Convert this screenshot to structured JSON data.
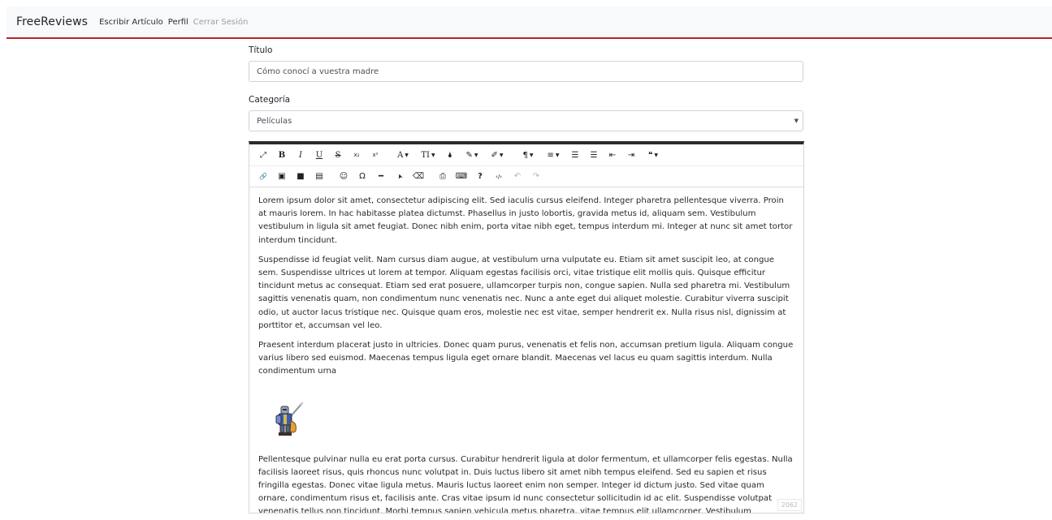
{
  "navbar": {
    "brand": "FreeReviews",
    "links": [
      "Escribir Artículo",
      "Perfil",
      "Cerrar Sesión"
    ]
  },
  "form": {
    "title_label": "Título",
    "title_value": "Cómo conocí a vuestra madre",
    "category_label": "Categoría",
    "category_value": "Películas"
  },
  "toolbar": {
    "row1": [
      {
        "name": "fullscreen-icon",
        "glyph": "⤢"
      },
      {
        "name": "bold-icon",
        "glyph": "B"
      },
      {
        "name": "italic-icon",
        "glyph": "I"
      },
      {
        "name": "underline-icon",
        "glyph": "U"
      },
      {
        "name": "strikethrough-icon",
        "glyph": "S"
      },
      {
        "name": "subscript-icon",
        "glyph": "x₂"
      },
      {
        "name": "superscript-icon",
        "glyph": "x²"
      },
      {
        "name": "font-family-icon",
        "glyph": "A"
      },
      {
        "name": "font-size-icon",
        "glyph": "TI"
      },
      {
        "name": "text-color-icon",
        "glyph": "🌢"
      },
      {
        "name": "background-color-icon",
        "glyph": "✎"
      },
      {
        "name": "inline-style-icon",
        "glyph": "✐"
      },
      {
        "name": "paragraph-format-icon",
        "glyph": "¶"
      },
      {
        "name": "align-icon",
        "glyph": "≡"
      },
      {
        "name": "ordered-list-icon",
        "glyph": "☰"
      },
      {
        "name": "unordered-list-icon",
        "glyph": "☰"
      },
      {
        "name": "outdent-icon",
        "glyph": "⇤"
      },
      {
        "name": "indent-icon",
        "glyph": "⇥"
      },
      {
        "name": "quote-icon",
        "glyph": "❝"
      }
    ],
    "row2": [
      {
        "name": "link-icon",
        "glyph": "🔗"
      },
      {
        "name": "image-icon",
        "glyph": "▣"
      },
      {
        "name": "video-icon",
        "glyph": "■"
      },
      {
        "name": "table-icon",
        "glyph": "▤"
      },
      {
        "name": "emoticon-icon",
        "glyph": "☺"
      },
      {
        "name": "special-characters-icon",
        "glyph": "Ω"
      },
      {
        "name": "horizontal-line-icon",
        "glyph": "━"
      },
      {
        "name": "select-all-icon",
        "glyph": "➤"
      },
      {
        "name": "clear-formatting-icon",
        "glyph": "⌫"
      },
      {
        "name": "print-icon",
        "glyph": "⎙"
      },
      {
        "name": "keyboard-icon",
        "glyph": "⌨"
      },
      {
        "name": "help-icon",
        "glyph": "?"
      },
      {
        "name": "code-view-icon",
        "glyph": "‹/›"
      },
      {
        "name": "undo-icon",
        "glyph": "↶"
      },
      {
        "name": "redo-icon",
        "glyph": "↷"
      }
    ]
  },
  "editor": {
    "paragraphs": [
      "Lorem ipsum dolor sit amet, consectetur adipiscing elit. Sed iaculis cursus eleifend. Integer pharetra pellentesque viverra. Proin at mauris lorem. In hac habitasse platea dictumst. Phasellus in justo lobortis, gravida metus id, aliquam sem. Vestibulum vestibulum in ligula sit amet feugiat. Donec nibh enim, porta vitae nibh eget, tempus interdum mi. Integer at nunc sit amet tortor interdum tincidunt.",
      "Suspendisse id feugiat velit. Nam cursus diam augue, at vestibulum urna vulputate eu. Etiam sit amet suscipit leo, at congue sem. Suspendisse ultrices ut lorem at tempor. Aliquam egestas facilisis orci, vitae tristique elit mollis quis. Quisque efficitur tincidunt metus ac consequat. Etiam sed erat posuere, ullamcorper turpis non, congue sapien. Nulla sed pharetra mi. Vestibulum sagittis venenatis quam, non condimentum nunc venenatis nec. Nunc a ante eget dui aliquet molestie. Curabitur viverra suscipit odio, ut auctor lacus tristique nec. Quisque quam eros, molestie nec est vitae, semper hendrerit ex. Nulla risus nisl, dignissim at porttitor et, accumsan vel leo.",
      "Praesent interdum placerat justo in ultricies. Donec quam purus, venenatis et felis non, accumsan pretium ligula. Aliquam congue varius libero sed euismod. Maecenas tempus ligula eget ornare blandit. Maecenas vel lacus eu quam sagittis interdum. Nulla condimentum urna",
      "Pellentesque pulvinar nulla eu erat porta cursus. Curabitur hendrerit ligula at dolor fermentum, et ullamcorper felis egestas. Nulla facilisis laoreet risus, quis rhoncus nunc volutpat in. Duis luctus libero sit amet nibh tempus eleifend. Sed eu sapien et risus fringilla egestas. Donec vitae ligula metus. Mauris luctus laoreet enim non semper. Integer id dictum justo. Sed vitae quam ornare, condimentum risus et, facilisis ante. Cras vitae ipsum id nunc consectetur sollicitudin id ac elit. Suspendisse volutpat venenatis tellus non tincidunt. Morbi tempus sapien vehicula metus pharetra, vitae tempus elit ullamcorper. Vestibulum accumsan massa ac tortor laoreet dignissim. Aliquam pharetra viverra mi eu bibendum."
    ],
    "char_count": "2062"
  },
  "colors": {
    "navbar_bg": "#f8f9fa",
    "navbar_accent": "#b3262b",
    "editor_top_border": "#2b2b2b"
  }
}
